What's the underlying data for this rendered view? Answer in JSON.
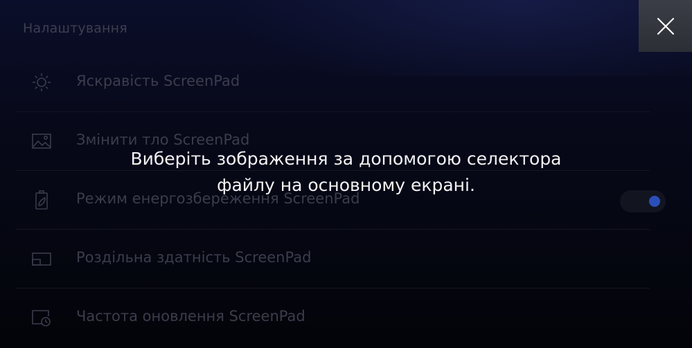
{
  "panel": {
    "title": "Налаштування"
  },
  "settings": {
    "items": [
      {
        "label": "Яскравість ScreenPad",
        "icon": "brightness-icon"
      },
      {
        "label": "Змінити тло ScreenPad",
        "icon": "wallpaper-icon"
      },
      {
        "label": "Режим енергозбереження ScreenPad",
        "icon": "battery-saver-icon",
        "toggle_on": true
      },
      {
        "label": "Роздільна здатність ScreenPad",
        "icon": "resolution-icon"
      },
      {
        "label": "Частота оновлення ScreenPad",
        "icon": "refresh-rate-icon"
      }
    ]
  },
  "overlay": {
    "line1": "Виберіть зображення за допомогою селектора",
    "line2": "файлу на основному екрані."
  },
  "close": {
    "icon": "close-icon"
  },
  "colors": {
    "accent": "#2a4fb8",
    "dim_text": "#3b3d4c",
    "message_text": "#f2f2f4"
  }
}
